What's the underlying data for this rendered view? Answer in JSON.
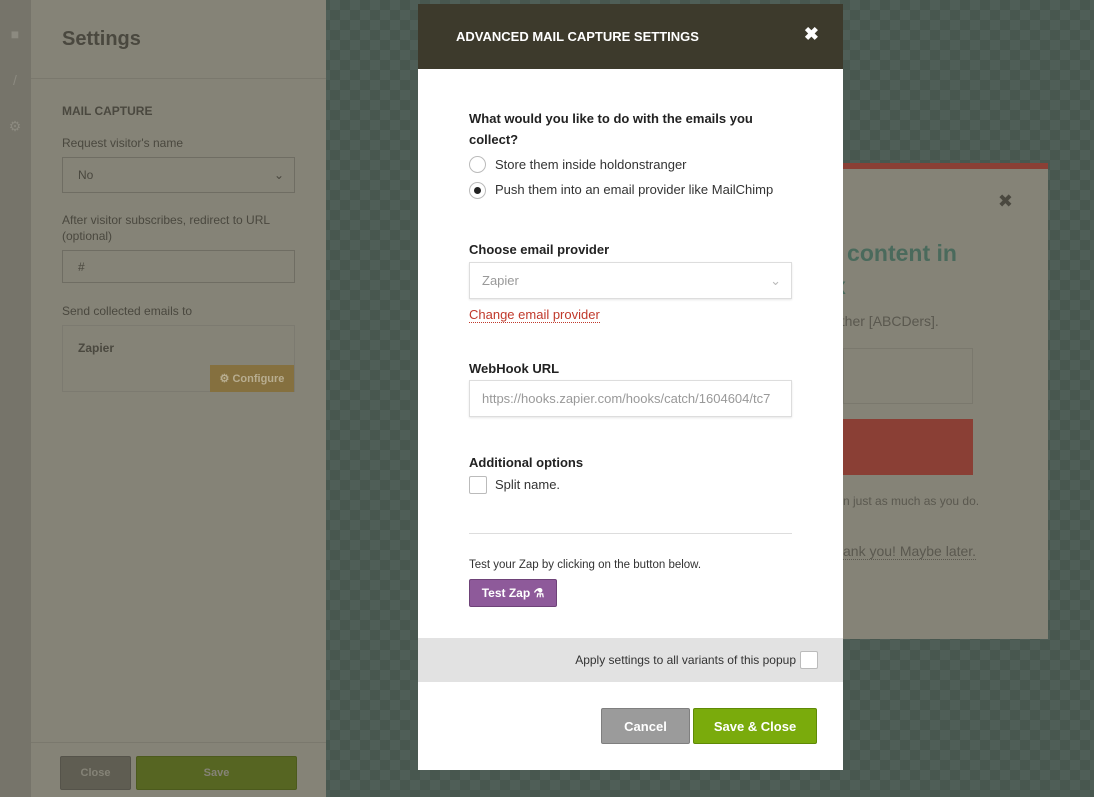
{
  "sidebar": {
    "icons": [
      "square-icon",
      "brush-icon",
      "gears-icon"
    ]
  },
  "settings": {
    "title": "Settings",
    "section": "MAIL CAPTURE",
    "request_name_label": "Request visitor's name",
    "request_name_value": "No",
    "redirect_label": "After visitor subscribes, redirect to URL (optional)",
    "redirect_value": "#",
    "send_to_label": "Send collected emails to",
    "provider": "Zapier",
    "configure_label": "Configure",
    "close_label": "Close",
    "save_label": "Save"
  },
  "preview": {
    "heading_1": "] content in",
    "heading_2": "x",
    "subtext": "other [ABCDers].",
    "note": "n just as much as you do.",
    "decline": "ank you! Maybe later."
  },
  "modal": {
    "title": "ADVANCED MAIL CAPTURE SETTINGS",
    "question": "What would you like to do with the emails you collect?",
    "options": [
      {
        "label": "Store them inside holdonstranger",
        "selected": false
      },
      {
        "label": "Push them into an email provider like MailChimp",
        "selected": true
      }
    ],
    "provider_label": "Choose email provider",
    "provider_value": "Zapier",
    "change_provider": "Change email provider",
    "webhook_label": "WebHook URL",
    "webhook_value": "https://hooks.zapier.com/hooks/catch/1604604/tc7",
    "additional_label": "Additional options",
    "split_name": "Split name.",
    "split_name_checked": false,
    "test_text": "Test your Zap by clicking on the button below.",
    "test_button": "Test Zap",
    "apply_all": "Apply settings to all variants of this popup",
    "apply_all_checked": false,
    "cancel": "Cancel",
    "save_close": "Save & Close"
  },
  "colors": {
    "header": "#3d3a2c",
    "save": "#7aab0c",
    "cancel": "#9b9b9b",
    "test": "#8e5a9a",
    "link": "#c0392b"
  }
}
